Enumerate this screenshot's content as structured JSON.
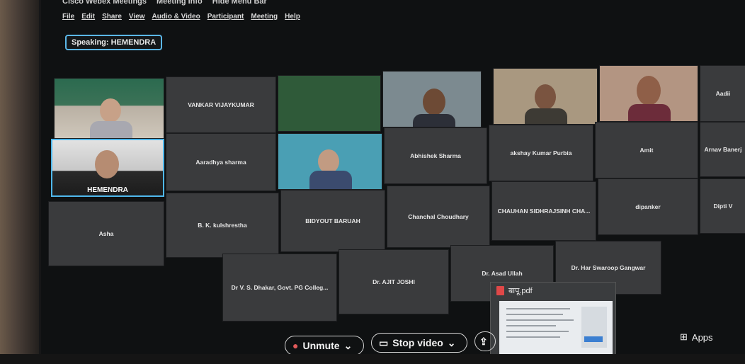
{
  "window": {
    "app": "Cisco Webex Meetings",
    "meeting_info": "Meeting Info",
    "hide_menu": "Hide Menu Bar"
  },
  "menu": [
    "File",
    "Edit",
    "Share",
    "View",
    "Audio & Video",
    "Participant",
    "Meeting",
    "Help"
  ],
  "speaking": "Speaking: HEMENDRA",
  "participants": {
    "vankar": "VANKAR VIJAYKUMAR",
    "aadii": "Aadii",
    "hemendra": "HEMENDRA",
    "aaradhya": "Aaradhya sharma",
    "abhishek": "Abhishek Sharma",
    "akshay": "akshay Kumar Purbia",
    "amit": "Amit",
    "arnav": "Arnav Banerj",
    "asha": "Asha",
    "bk": "B. K. kulshrestha",
    "bidyout": "BIDYOUT BARUAH",
    "chanchal": "Chanchal Choudhary",
    "chauhan": "CHAUHAN SIDHRAJSINH CHA...",
    "dipanker": "dipanker",
    "dipti": "Dipti V",
    "dhakar": "Dr V. S. Dhakar, Govt. PG Colleg...",
    "ajit": "Dr. AJIT JOSHI",
    "asad": "Dr. Asad Ullah",
    "har": "Dr. Har Swaroop Gangwar"
  },
  "pdf": {
    "filename": "बापू.pdf"
  },
  "controls": {
    "unmute": "Unmute",
    "stop_video": "Stop video",
    "share": "Share",
    "apps": "Apps"
  },
  "colors": {
    "accent": "#4fb8ec",
    "tile": "#3a3b3d"
  }
}
